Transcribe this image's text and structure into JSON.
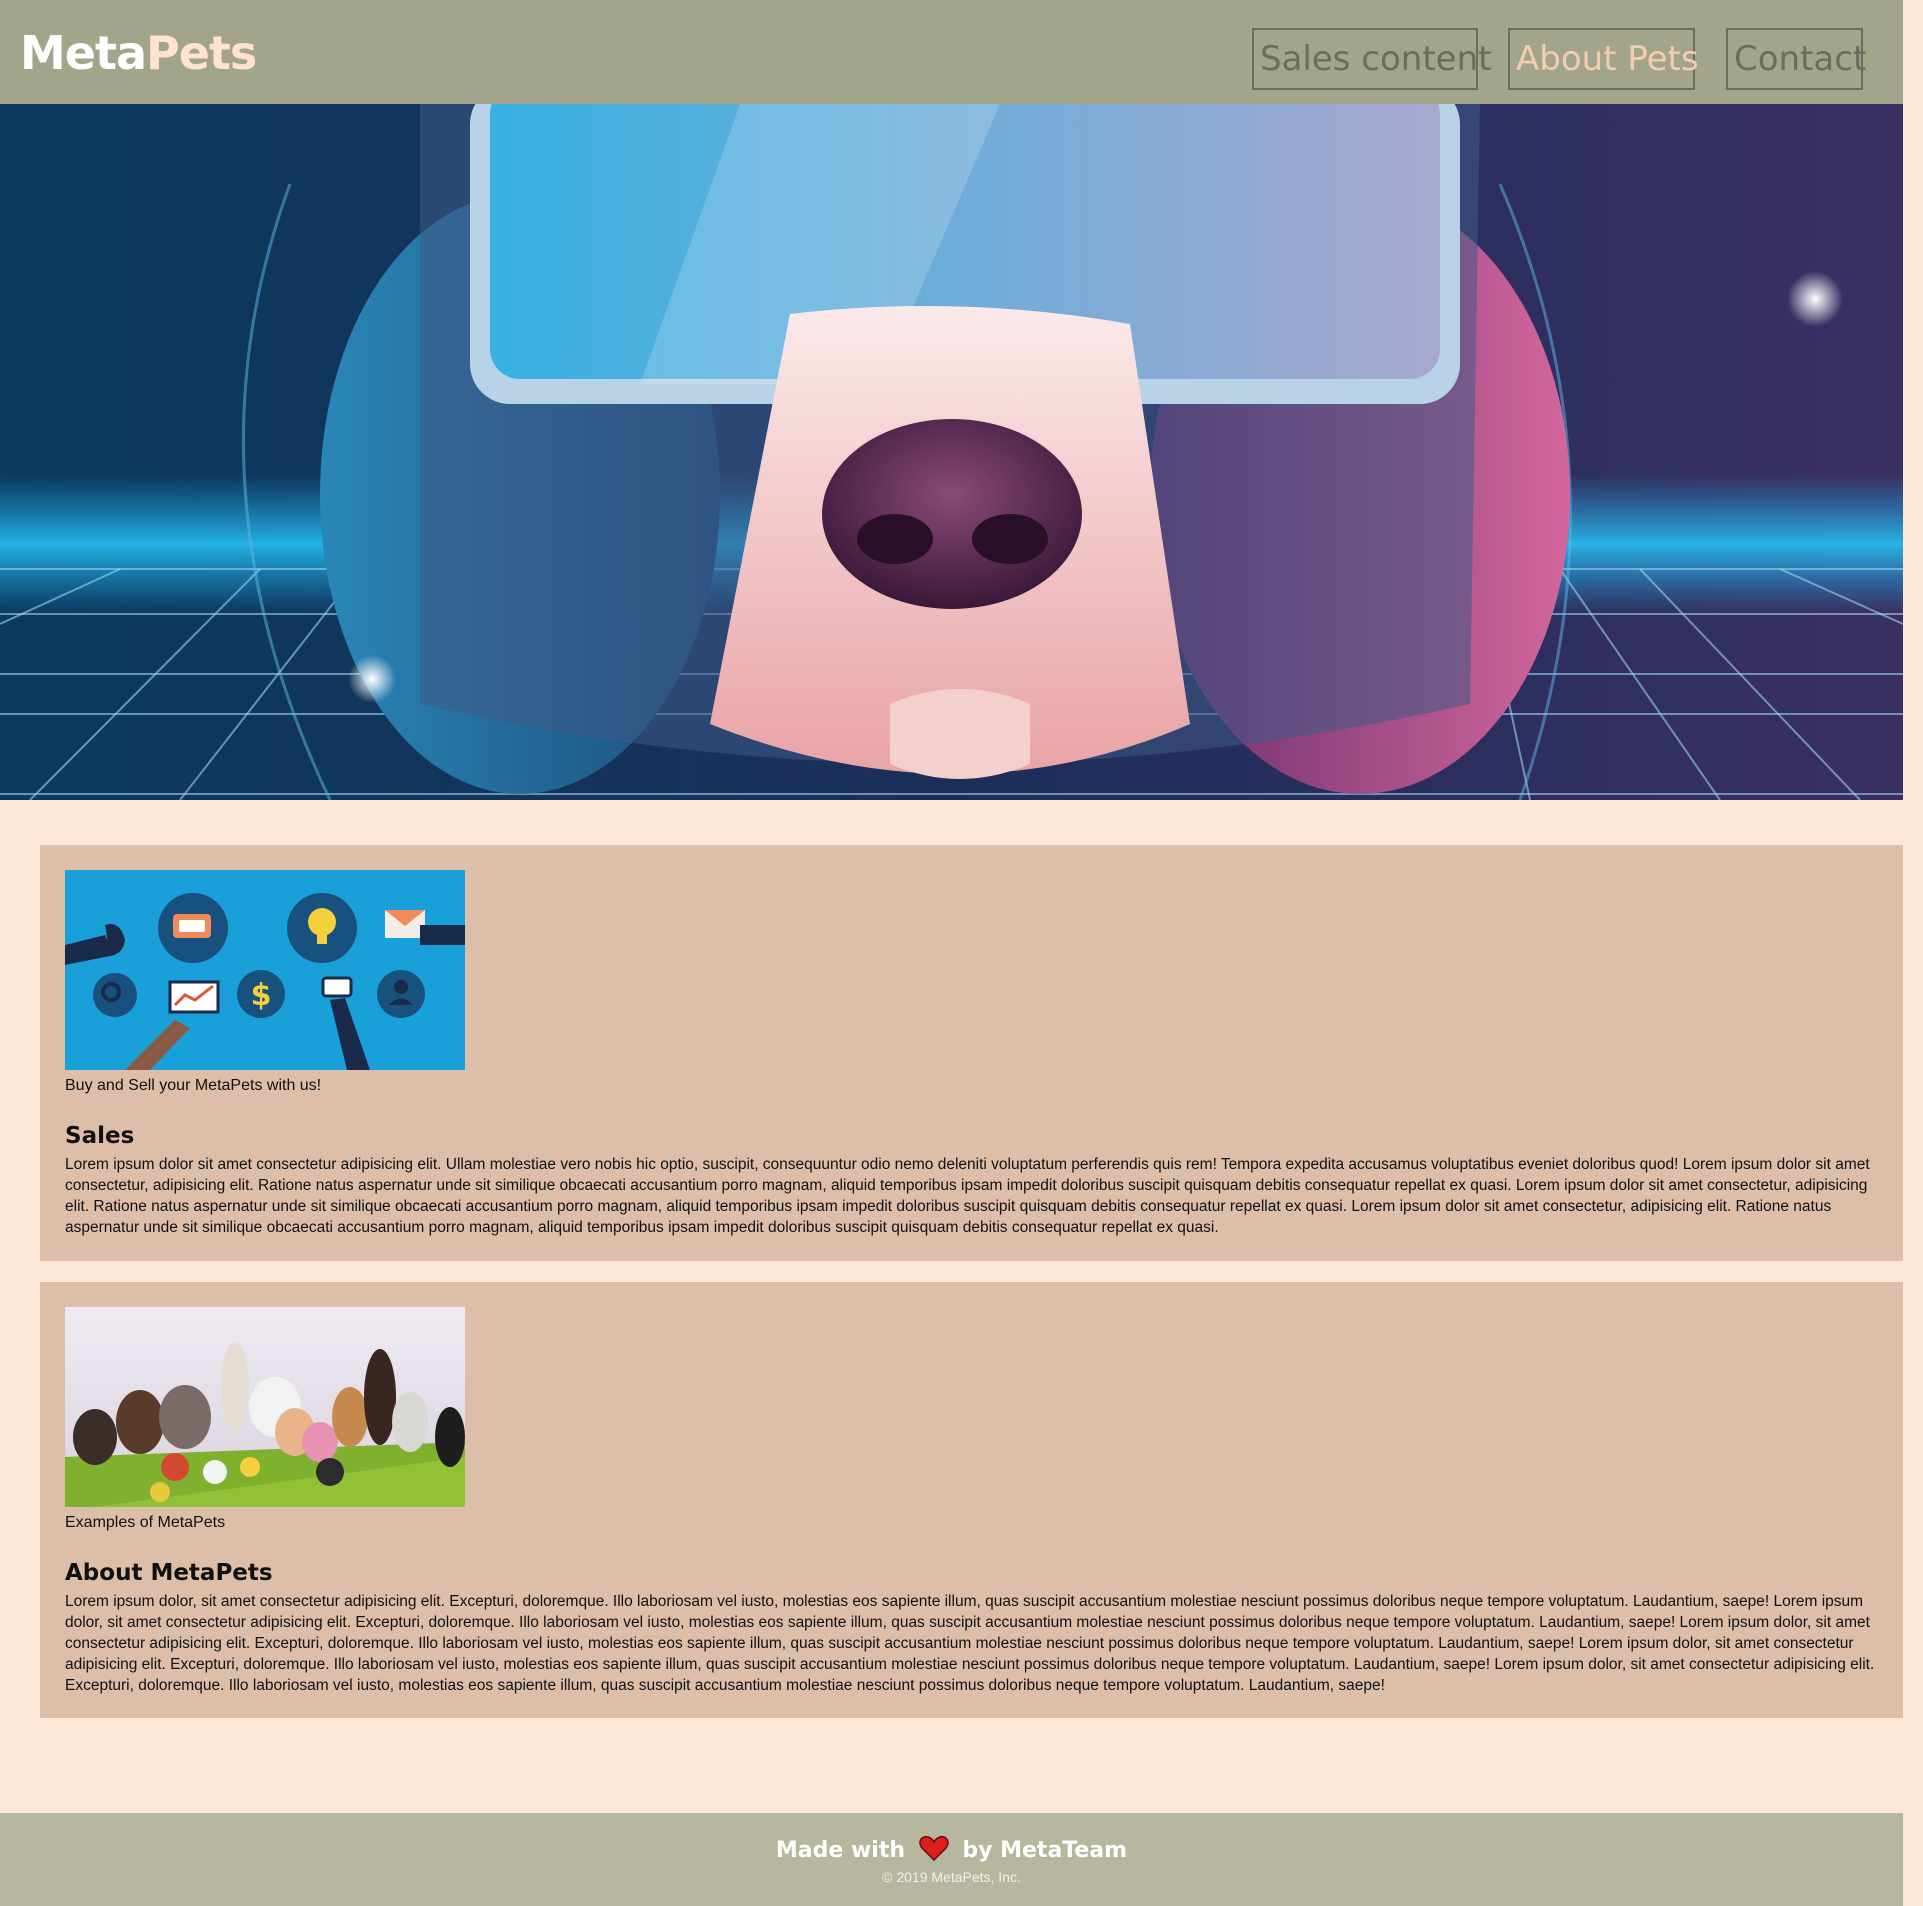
{
  "header": {
    "logo_main": "Meta",
    "logo_accent": "Pets",
    "nav": {
      "sales": "Sales content",
      "about": "About Pets",
      "contact": "Contact"
    }
  },
  "hero": {
    "image_icon": "vr-dog-hero-image"
  },
  "sales": {
    "caption": "Buy and Sell your MetaPets with us!",
    "title": "Sales",
    "body": "Lorem ipsum dolor sit amet consectetur adipisicing elit. Ullam molestiae vero nobis hic optio, suscipit, consequuntur odio nemo deleniti voluptatum perferendis quis rem! Tempora expedita accusamus voluptatibus eveniet doloribus quod! Lorem ipsum dolor sit amet consectetur, adipisicing elit. Ratione natus aspernatur unde sit similique obcaecati accusantium porro magnam, aliquid temporibus ipsam impedit doloribus suscipit quisquam debitis consequatur repellat ex quasi. Lorem ipsum dolor sit amet consectetur, adipisicing elit. Ratione natus aspernatur unde sit similique obcaecati accusantium porro magnam, aliquid temporibus ipsam impedit doloribus suscipit quisquam debitis consequatur repellat ex quasi. Lorem ipsum dolor sit amet consectetur, adipisicing elit. Ratione natus aspernatur unde sit similique obcaecati accusantium porro magnam, aliquid temporibus ipsam impedit doloribus suscipit quisquam debitis consequatur repellat ex quasi."
  },
  "about": {
    "caption": "Examples of MetaPets",
    "title": "About MetaPets",
    "body": "Lorem ipsum dolor, sit amet consectetur adipisicing elit. Excepturi, doloremque. Illo laboriosam vel iusto, molestias eos sapiente illum, quas suscipit accusantium molestiae nesciunt possimus doloribus neque tempore voluptatum. Laudantium, saepe! Lorem ipsum dolor, sit amet consectetur adipisicing elit. Excepturi, doloremque. Illo laboriosam vel iusto, molestias eos sapiente illum, quas suscipit accusantium molestiae nesciunt possimus doloribus neque tempore voluptatum. Laudantium, saepe! Lorem ipsum dolor, sit amet consectetur adipisicing elit. Excepturi, doloremque. Illo laboriosam vel iusto, molestias eos sapiente illum, quas suscipit accusantium molestiae nesciunt possimus doloribus neque tempore voluptatum. Laudantium, saepe! Lorem ipsum dolor, sit amet consectetur adipisicing elit. Excepturi, doloremque. Illo laboriosam vel iusto, molestias eos sapiente illum, quas suscipit accusantium molestiae nesciunt possimus doloribus neque tempore voluptatum. Laudantium, saepe! Lorem ipsum dolor, sit amet consectetur adipisicing elit. Excepturi, doloremque. Illo laboriosam vel iusto, molestias eos sapiente illum, quas suscipit accusantium molestiae nesciunt possimus doloribus neque tempore voluptatum. Laudantium, saepe!"
  },
  "footer": {
    "made_with": "Made with",
    "by": "by MetaTeam",
    "copyright": "© 2019 MetaPets, Inc.",
    "heart_icon": "heart-icon"
  },
  "colors": {
    "header_bg": "#a3a58b",
    "page_bg": "#ffe7d8",
    "card_bg": "#dcbea9",
    "footer_bg": "#b6b79e",
    "nav_active": "#f2cdb2"
  }
}
